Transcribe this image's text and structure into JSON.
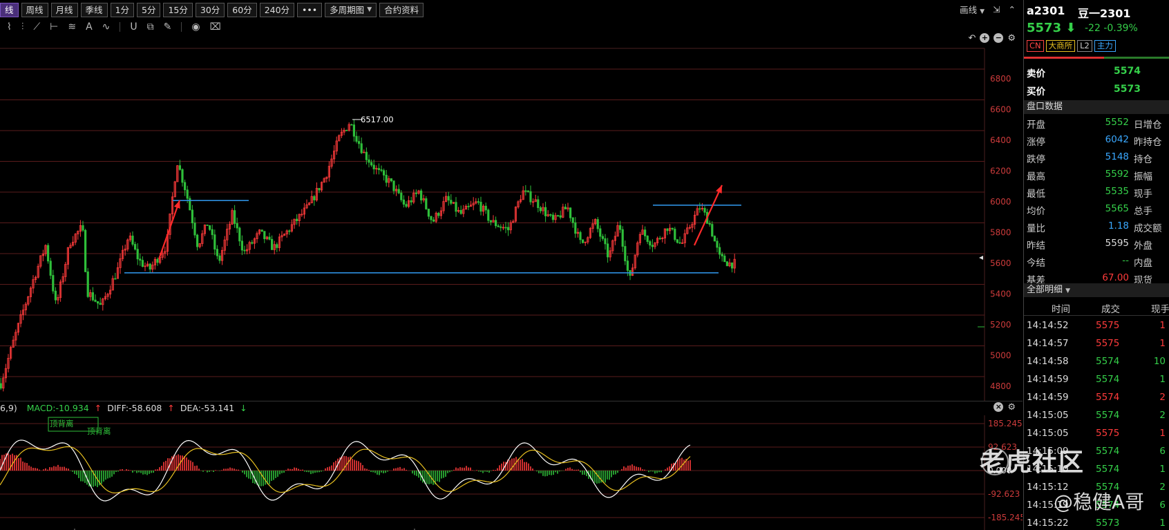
{
  "toolbar": {
    "periods": [
      "线",
      "周线",
      "月线",
      "季线",
      "1分",
      "5分",
      "15分",
      "30分",
      "60分",
      "240分"
    ],
    "more": "•••",
    "multi_period": "多周期图",
    "contract_info": "合约资料",
    "draw_label": "画线",
    "win_ctrl": [
      "⇲",
      "⌃"
    ]
  },
  "chart": {
    "y_ticks": [
      "6800",
      "6600",
      "6400",
      "6200",
      "6000",
      "5800",
      "5600",
      "5400",
      "5200",
      "5000",
      "4800"
    ],
    "high_label": "6517.00",
    "support_line_value": 5520,
    "resistance_line_value": 5960,
    "upper_line_start_value": 5990
  },
  "macd": {
    "params": "6,9)",
    "macd_label": "MACD:-10.934",
    "diff_label": "DIFF:-58.608",
    "dea_label": "DEA:-53.141",
    "y_ticks": [
      "185.245",
      "92.623",
      "0.000",
      "-92.623",
      "-185.245"
    ],
    "annot1": "顶背离",
    "annot2": "顶背离"
  },
  "quote": {
    "code": "a2301",
    "name": "豆一2301",
    "last": "5573",
    "change": "-22  -0.39%",
    "tags": [
      "CN",
      "大商所",
      "L2",
      "主力"
    ],
    "ask_label": "卖价",
    "ask": "5574",
    "bid_label": "买价",
    "bid": "5573",
    "section": "盘口数据",
    "rows": [
      {
        "l": "开盘",
        "v": "5552",
        "c": "g",
        "l2": "日增仓"
      },
      {
        "l": "涨停",
        "v": "6042",
        "c": "b",
        "l2": "昨持仓"
      },
      {
        "l": "跌停",
        "v": "5148",
        "c": "b",
        "l2": "持仓"
      },
      {
        "l": "最高",
        "v": "5592",
        "c": "g",
        "l2": "振幅"
      },
      {
        "l": "最低",
        "v": "5535",
        "c": "g",
        "l2": "现手"
      },
      {
        "l": "均价",
        "v": "5565",
        "c": "g",
        "l2": "总手"
      },
      {
        "l": "量比",
        "v": "1.18",
        "c": "b",
        "l2": "成交额"
      },
      {
        "l": "昨结",
        "v": "5595",
        "c": "w",
        "l2": "外盘"
      },
      {
        "l": "今结",
        "v": "--",
        "c": "g",
        "l2": "内盘"
      },
      {
        "l": "基差",
        "v": "67.00",
        "c": "r",
        "l2": "现货"
      }
    ],
    "detail_section": "全部明细",
    "table_headers": [
      "时间",
      "成交",
      "现手"
    ],
    "trades": [
      {
        "t": "14:14:52",
        "p": "5575",
        "q": "1",
        "qc": "r"
      },
      {
        "t": "14:14:57",
        "p": "5575",
        "q": "1",
        "qc": "r"
      },
      {
        "t": "14:14:58",
        "p": "5574",
        "q": "10",
        "qc": "g"
      },
      {
        "t": "14:14:59",
        "p": "5574",
        "q": "1",
        "qc": "g"
      },
      {
        "t": "14:14:59",
        "p": "5574",
        "q": "2",
        "qc": "r"
      },
      {
        "t": "14:15:05",
        "p": "5574",
        "q": "2",
        "qc": "g"
      },
      {
        "t": "14:15:05",
        "p": "5575",
        "q": "1",
        "qc": "r"
      },
      {
        "t": "14:15:09",
        "p": "5574",
        "q": "6",
        "qc": "g"
      },
      {
        "t": "14:15:10",
        "p": "5574",
        "q": "1",
        "qc": "g"
      },
      {
        "t": "14:15:12",
        "p": "5574",
        "q": "2",
        "qc": "g"
      },
      {
        "t": "14:15:19",
        "p": "5574",
        "q": "6",
        "qc": "g"
      },
      {
        "t": "14:15:22",
        "p": "5573",
        "q": "1",
        "qc": "g"
      }
    ]
  },
  "watermark": {
    "brand": "老虎社区",
    "author": "@稳健A哥"
  }
}
